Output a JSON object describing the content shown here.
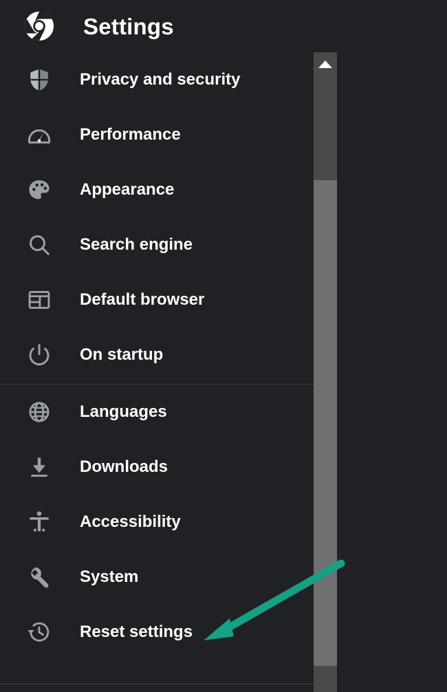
{
  "window": {
    "background_color": "#202124",
    "text_color": "#ffffff",
    "icon_color": "#9aa0a6",
    "divider_color": "#3c4043"
  },
  "header": {
    "logo_icon": "chrome-logo-icon",
    "title": "Settings"
  },
  "sidebar": {
    "groups": [
      {
        "items": [
          {
            "icon": "shield-icon",
            "label": "Privacy and security"
          },
          {
            "icon": "speedometer-icon",
            "label": "Performance"
          },
          {
            "icon": "palette-icon",
            "label": "Appearance"
          },
          {
            "icon": "search-icon",
            "label": "Search engine"
          },
          {
            "icon": "browser-window-icon",
            "label": "Default browser"
          },
          {
            "icon": "power-icon",
            "label": "On startup"
          }
        ]
      },
      {
        "items": [
          {
            "icon": "globe-icon",
            "label": "Languages"
          },
          {
            "icon": "download-icon",
            "label": "Downloads"
          },
          {
            "icon": "accessibility-icon",
            "label": "Accessibility"
          },
          {
            "icon": "wrench-icon",
            "label": "System"
          },
          {
            "icon": "history-restore-icon",
            "label": "Reset settings"
          }
        ]
      }
    ]
  },
  "scrollbar": {
    "up_arrow_icon": "scroll-up-arrow-icon",
    "track_color": "#4a4a4a",
    "thumb_color": "#6e7072"
  },
  "annotation": {
    "type": "arrow",
    "color": "#16a085",
    "points_to": "Reset settings"
  }
}
